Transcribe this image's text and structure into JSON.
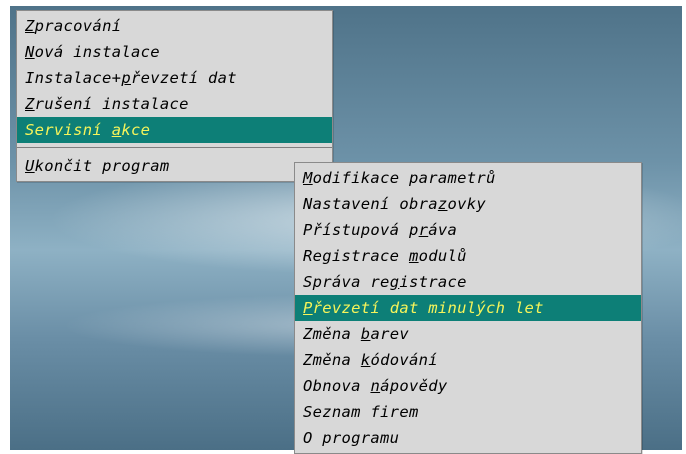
{
  "main_menu": {
    "items": [
      {
        "pre": "",
        "u": "Z",
        "post": "pracování"
      },
      {
        "pre": "",
        "u": "N",
        "post": "ová instalace"
      },
      {
        "pre": "Instalace+",
        "u": "p",
        "post": "řevzetí dat"
      },
      {
        "pre": "",
        "u": "Z",
        "post": "rušení instalace"
      },
      {
        "pre": "Servisní ",
        "u": "a",
        "post": "kce"
      }
    ],
    "exit": {
      "pre": "",
      "u": "U",
      "post": "končit program"
    }
  },
  "sub_menu": {
    "items": [
      {
        "pre": "",
        "u": "M",
        "post": "odifikace parametrů"
      },
      {
        "pre": "Nastavení obra",
        "u": "z",
        "post": "ovky"
      },
      {
        "pre": "Přístupová p",
        "u": "r",
        "post": "áva"
      },
      {
        "pre": "Registrace ",
        "u": "m",
        "post": "odulů"
      },
      {
        "pre": "Správa re",
        "u": "g",
        "post": "istrace"
      },
      {
        "pre": "",
        "u": "P",
        "post": "řevzetí dat minulých let"
      },
      {
        "pre": "Změna ",
        "u": "b",
        "post": "arev"
      },
      {
        "pre": "Změna ",
        "u": "k",
        "post": "ódování"
      },
      {
        "pre": "Obnova ",
        "u": "n",
        "post": "ápovědy"
      },
      {
        "pre": "Seznam firem",
        "u": "",
        "post": ""
      },
      {
        "pre": "O programu",
        "u": "",
        "post": ""
      }
    ]
  },
  "colors": {
    "menu_bg": "#d8d8d8",
    "selected_bg": "#0d7f77",
    "selected_text": "#f6f45a"
  }
}
